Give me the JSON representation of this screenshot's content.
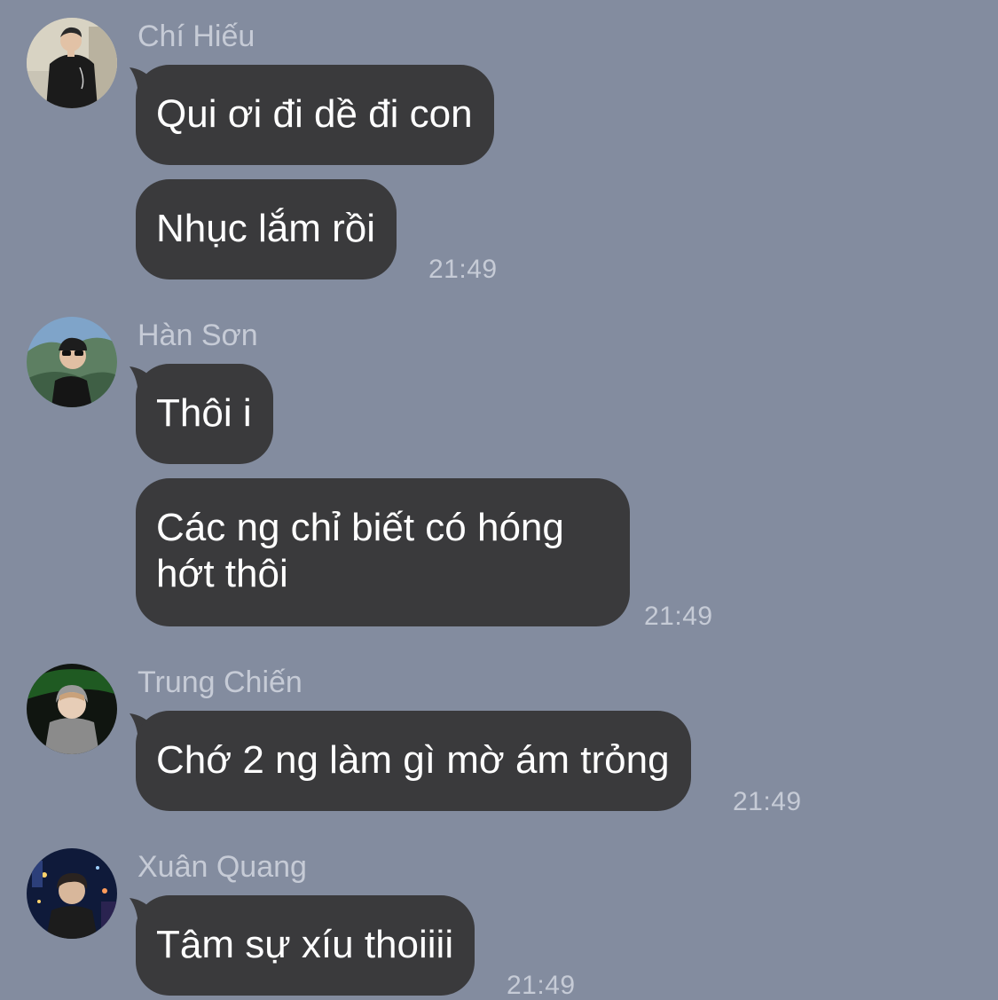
{
  "messages": [
    {
      "sender": "Chí Hiếu",
      "avatar_icon": "avatar-chi-hieu",
      "bubbles": [
        "Qui ơi đi dề đi con",
        "Nhục lắm rồi"
      ],
      "time": "21:49"
    },
    {
      "sender": "Hàn Sơn",
      "avatar_icon": "avatar-han-son",
      "bubbles": [
        "Thôi i",
        "Các ng chỉ biết có hóng hớt thôi"
      ],
      "time": "21:49"
    },
    {
      "sender": "Trung Chiến",
      "avatar_icon": "avatar-trung-chien",
      "bubbles": [
        "Chớ 2 ng làm gì mờ ám trỏng"
      ],
      "time": "21:49"
    },
    {
      "sender": "Xuân Quang",
      "avatar_icon": "avatar-xuan-quang",
      "bubbles": [
        "Tâm sự xíu thoiiii"
      ],
      "time": "21:49"
    }
  ],
  "colors": {
    "background": "#838c9f",
    "bubble": "#3a3a3c",
    "bubble_text": "#ffffff",
    "meta_text": "#c6cbd6"
  }
}
